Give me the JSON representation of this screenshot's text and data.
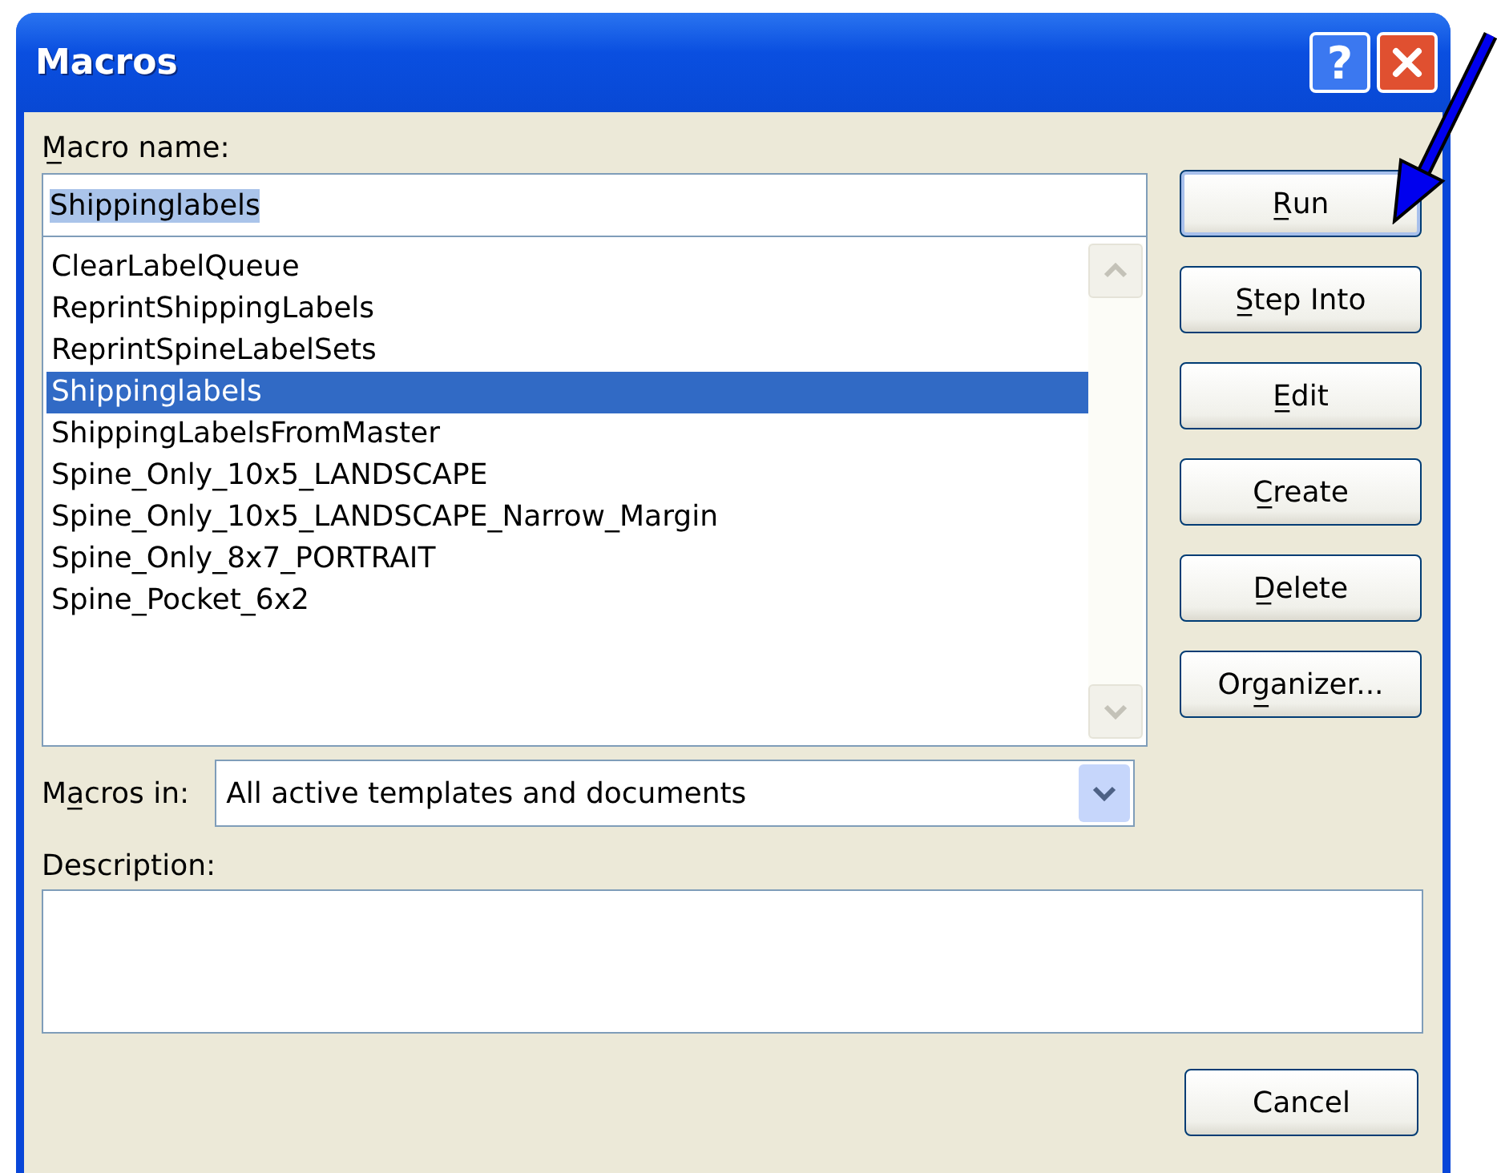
{
  "window": {
    "title": "Macros",
    "help_button": "?"
  },
  "macro_name": {
    "label": "M̲acro name:",
    "value": "Shippinglabels",
    "value_selected": true
  },
  "macros": [
    {
      "name": "ClearLabelQueue",
      "selected": false
    },
    {
      "name": "ReprintShippingLabels",
      "selected": false
    },
    {
      "name": "ReprintSpineLabelSets",
      "selected": false
    },
    {
      "name": "Shippinglabels",
      "selected": true
    },
    {
      "name": "ShippingLabelsFromMaster",
      "selected": false
    },
    {
      "name": "Spine_Only_10x5_LANDSCAPE",
      "selected": false
    },
    {
      "name": "Spine_Only_10x5_LANDSCAPE_Narrow_Margin",
      "selected": false
    },
    {
      "name": "Spine_Only_8x7_PORTRAIT",
      "selected": false
    },
    {
      "name": "Spine_Pocket_6x2",
      "selected": false
    }
  ],
  "buttons": [
    {
      "label": "R̲un",
      "default": true
    },
    {
      "label": "S̲tep Into",
      "default": false
    },
    {
      "label": "E̲dit",
      "default": false
    },
    {
      "label": "C̲reate",
      "default": false
    },
    {
      "label": "D̲elete",
      "default": false
    },
    {
      "label": "Org̲anizer...",
      "default": false
    }
  ],
  "macros_in": {
    "label": "Ma̲cros in:",
    "value": "All active templates and documents"
  },
  "description": {
    "label": "Description:"
  },
  "cancel_button": {
    "label": "Cancel"
  }
}
